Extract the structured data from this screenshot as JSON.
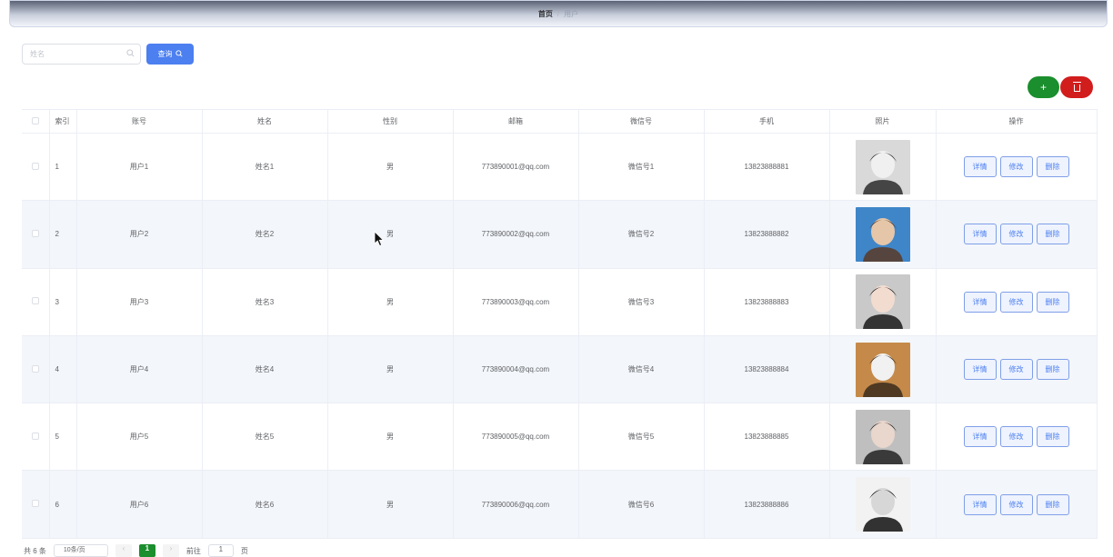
{
  "breadcrumb": {
    "home": "首页",
    "separator": "/",
    "current": "用户"
  },
  "search": {
    "placeholder": "姓名",
    "query_label": "查询"
  },
  "table": {
    "headers": {
      "index": "索引",
      "account": "账号",
      "name": "姓名",
      "gender": "性别",
      "email": "邮箱",
      "wechat": "微信号",
      "phone": "手机",
      "photo": "照片",
      "actions": "操作"
    },
    "action_labels": {
      "detail": "详情",
      "edit": "修改",
      "delete": "删除"
    },
    "rows": [
      {
        "index": "1",
        "account": "用户1",
        "name": "姓名1",
        "gender": "男",
        "email": "773890001@qq.com",
        "wechat": "微信号1",
        "phone": "13823888881"
      },
      {
        "index": "2",
        "account": "用户2",
        "name": "姓名2",
        "gender": "男",
        "email": "773890002@qq.com",
        "wechat": "微信号2",
        "phone": "13823888882"
      },
      {
        "index": "3",
        "account": "用户3",
        "name": "姓名3",
        "gender": "男",
        "email": "773890003@qq.com",
        "wechat": "微信号3",
        "phone": "13823888883"
      },
      {
        "index": "4",
        "account": "用户4",
        "name": "姓名4",
        "gender": "男",
        "email": "773890004@qq.com",
        "wechat": "微信号4",
        "phone": "13823888884"
      },
      {
        "index": "5",
        "account": "用户5",
        "name": "姓名5",
        "gender": "男",
        "email": "773890005@qq.com",
        "wechat": "微信号5",
        "phone": "13823888885"
      },
      {
        "index": "6",
        "account": "用户6",
        "name": "姓名6",
        "gender": "男",
        "email": "773890006@qq.com",
        "wechat": "微信号6",
        "phone": "13823888886"
      }
    ]
  },
  "pagination": {
    "total": "共 6 条",
    "page_size": "10条/页",
    "prev": "‹",
    "current_page": "1",
    "next": "›",
    "goto_label": "前往",
    "goto_value": "1",
    "page_unit": "页"
  },
  "colors": {
    "primary": "#4c7ff0",
    "add": "#1b8e2d",
    "delete": "#d21d1d"
  },
  "icons": {
    "search": "search-icon",
    "add": "plus-icon",
    "delete": "trash-icon",
    "cursor": "mouse-cursor-icon"
  }
}
